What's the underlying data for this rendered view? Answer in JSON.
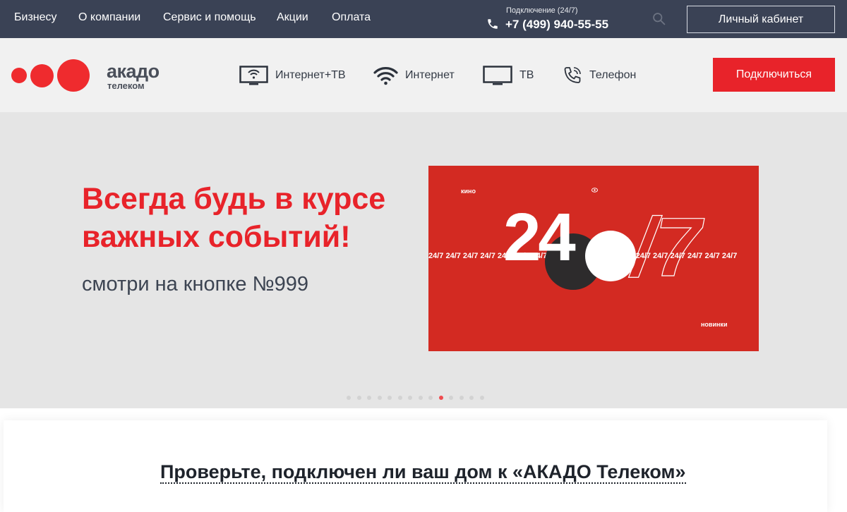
{
  "topbar": {
    "nav": [
      "Бизнесу",
      "О компании",
      "Сервис и помощь",
      "Акции",
      "Оплата"
    ],
    "phone_caption": "Подключение (24/7)",
    "phone_number": "+7 (499) 940-55-55",
    "account_label": "Личный кабинет"
  },
  "header": {
    "logo_word": "акадо",
    "logo_sub": "телеком",
    "services": [
      {
        "label": "Интернет+ТВ",
        "icon": "tv-wifi-icon"
      },
      {
        "label": "Интернет",
        "icon": "wifi-icon"
      },
      {
        "label": "ТВ",
        "icon": "tv-icon"
      },
      {
        "label": "Телефон",
        "icon": "phone-call-icon"
      }
    ],
    "connect_label": "Подключиться"
  },
  "banner": {
    "title": "Всегда будь в курсе важных событий!",
    "subtitle": "смотри на кнопке №999",
    "promo": {
      "label_top": "кино",
      "label_bottom": "новинки",
      "strip": "24/7 24/7 24/7 24/7 24/7 24/7 24/7 24/7 24/7 24/7 24/7 24/7 24/7 24/7 24/7 24/7 24/7 24/7",
      "big_24": "24",
      "big_7": "/7"
    },
    "slide_count": 14,
    "active_slide": 10
  },
  "check": {
    "title": "Проверьте, подключен ли ваш дом к «АКАДО Телеком»"
  },
  "colors": {
    "topbar": "#3a4255",
    "accent_red": "#e8232a",
    "promo_red": "#d32a22",
    "banner_bg": "#e5e5e5",
    "header_bg": "#f1f1f1"
  }
}
